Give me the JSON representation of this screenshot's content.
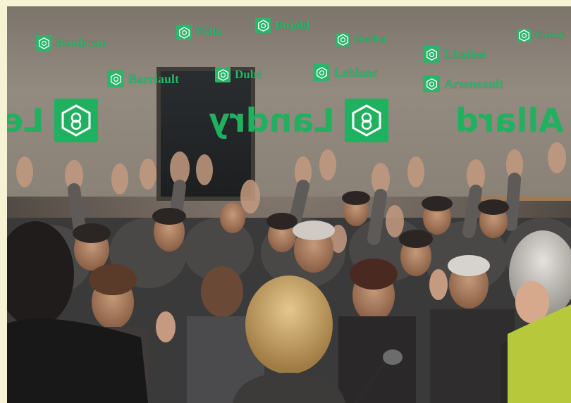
{
  "scene": {
    "description_colors": {
      "brand_green": "#2bb46a",
      "accent_lime": "#b7c93a",
      "paper_bg": "#f6f2d4"
    }
  },
  "small_names": [
    {
      "label": "Boudreau"
    },
    {
      "label": "Fallu"
    },
    {
      "label": "Bujold"
    },
    {
      "label": "Ouellet"
    },
    {
      "label": "Caissy"
    },
    {
      "label": "Litalien"
    },
    {
      "label": "Barriault"
    },
    {
      "label": "Dubé"
    },
    {
      "label": "Leblanc"
    },
    {
      "label": "Arseneault"
    }
  ],
  "large_names": [
    {
      "label": "Le"
    },
    {
      "label": "Landry"
    },
    {
      "label": "Allard"
    }
  ]
}
